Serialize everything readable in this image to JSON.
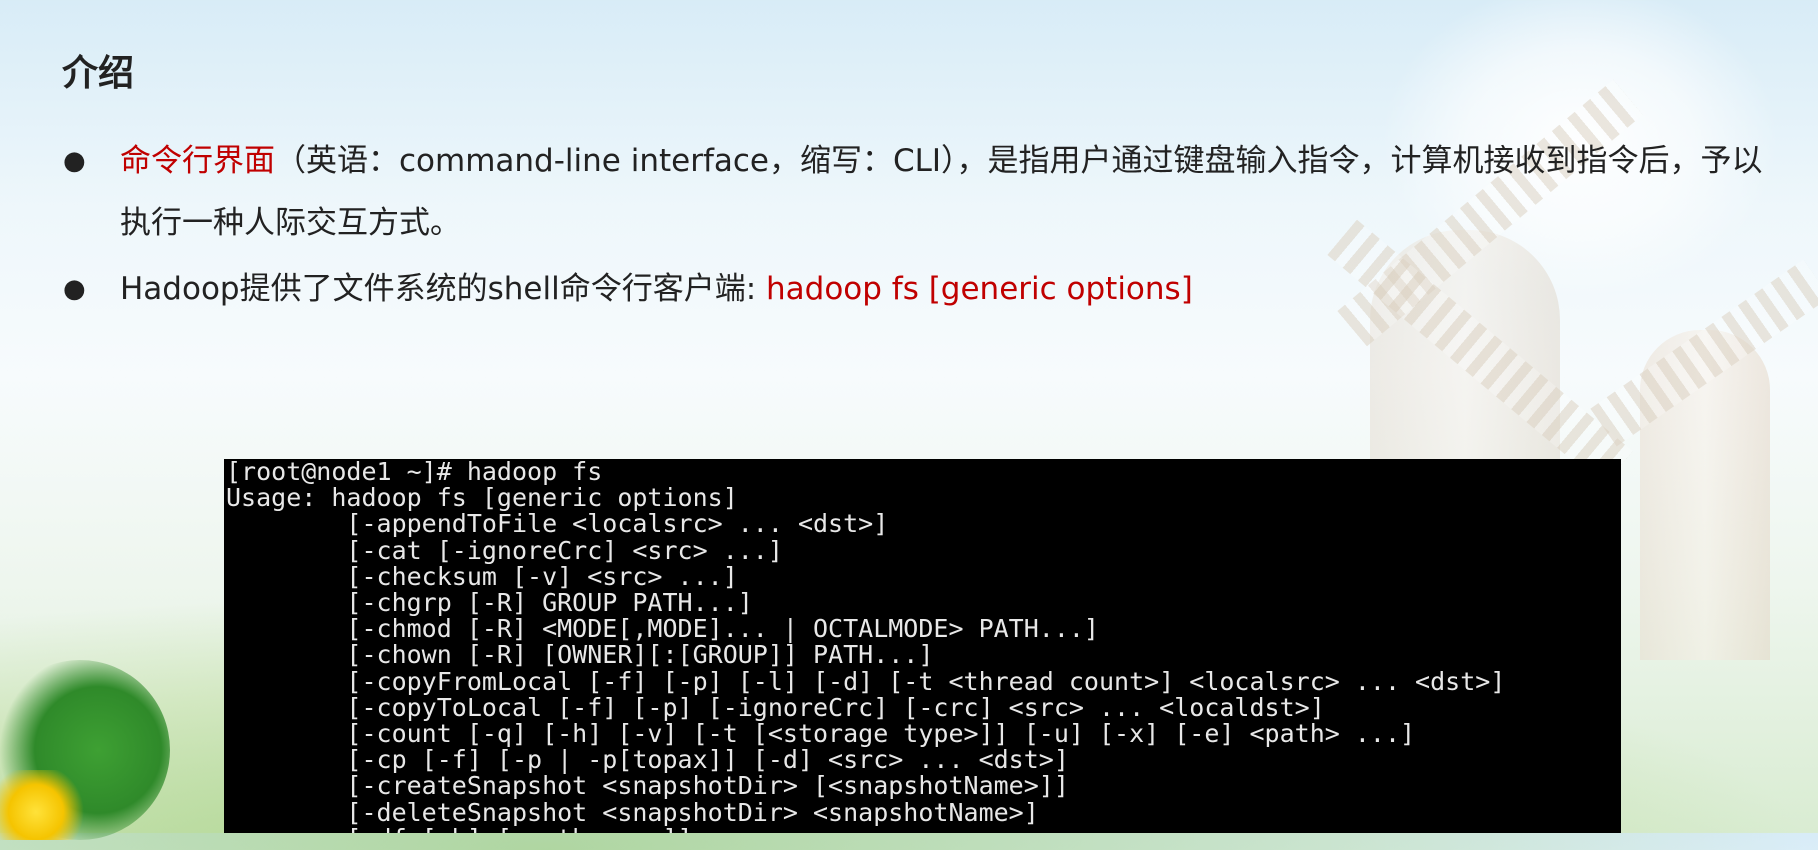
{
  "title": "介绍",
  "bullets": [
    {
      "highlight": "命令行界面",
      "text": "（英语：command-line interface，缩写：CLI），是指用户通过键盘输入指令，计算机接收到指令后，予以执行一种人际交互方式。"
    },
    {
      "text": "Hadoop提供了文件系统的shell命令行客户端: ",
      "highlight": "hadoop fs [generic options]"
    }
  ],
  "terminal": {
    "lines": [
      "[root@node1 ~]# hadoop fs",
      "Usage: hadoop fs [generic options]",
      "        [-appendToFile <localsrc> ... <dst>]",
      "        [-cat [-ignoreCrc] <src> ...]",
      "        [-checksum [-v] <src> ...]",
      "        [-chgrp [-R] GROUP PATH...]",
      "        [-chmod [-R] <MODE[,MODE]... | OCTALMODE> PATH...]",
      "        [-chown [-R] [OWNER][:[GROUP]] PATH...]",
      "        [-copyFromLocal [-f] [-p] [-l] [-d] [-t <thread count>] <localsrc> ... <dst>]",
      "        [-copyToLocal [-f] [-p] [-ignoreCrc] [-crc] <src> ... <localdst>]",
      "        [-count [-q] [-h] [-v] [-t [<storage type>]] [-u] [-x] [-e] <path> ...]",
      "        [-cp [-f] [-p | -p[topax]] [-d] <src> ... <dst>]",
      "        [-createSnapshot <snapshotDir> [<snapshotName>]]",
      "        [-deleteSnapshot <snapshotDir> <snapshotName>]",
      "        [-df [-h] [<path> ...]]"
    ]
  },
  "colors": {
    "highlight": "#c00000",
    "text": "#222222",
    "terminal_bg": "#000000"
  }
}
